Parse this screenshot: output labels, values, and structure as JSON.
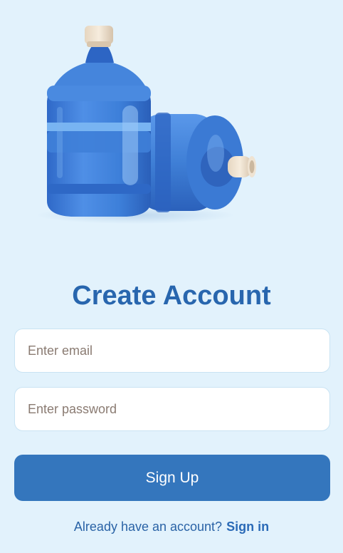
{
  "hero": {
    "image_name": "water-bottles-illustration"
  },
  "title": "Create Account",
  "form": {
    "email_placeholder": "Enter email",
    "password_placeholder": "Enter password",
    "signup_label": "Sign Up"
  },
  "footer": {
    "prompt": "Already have an account?",
    "signin_label": "Sign in"
  },
  "colors": {
    "background": "#e2f2fc",
    "title": "#2866ae",
    "primary_button": "#3476bd",
    "link": "#2a6ab7",
    "bottle_blue": "#3f7fd4"
  }
}
